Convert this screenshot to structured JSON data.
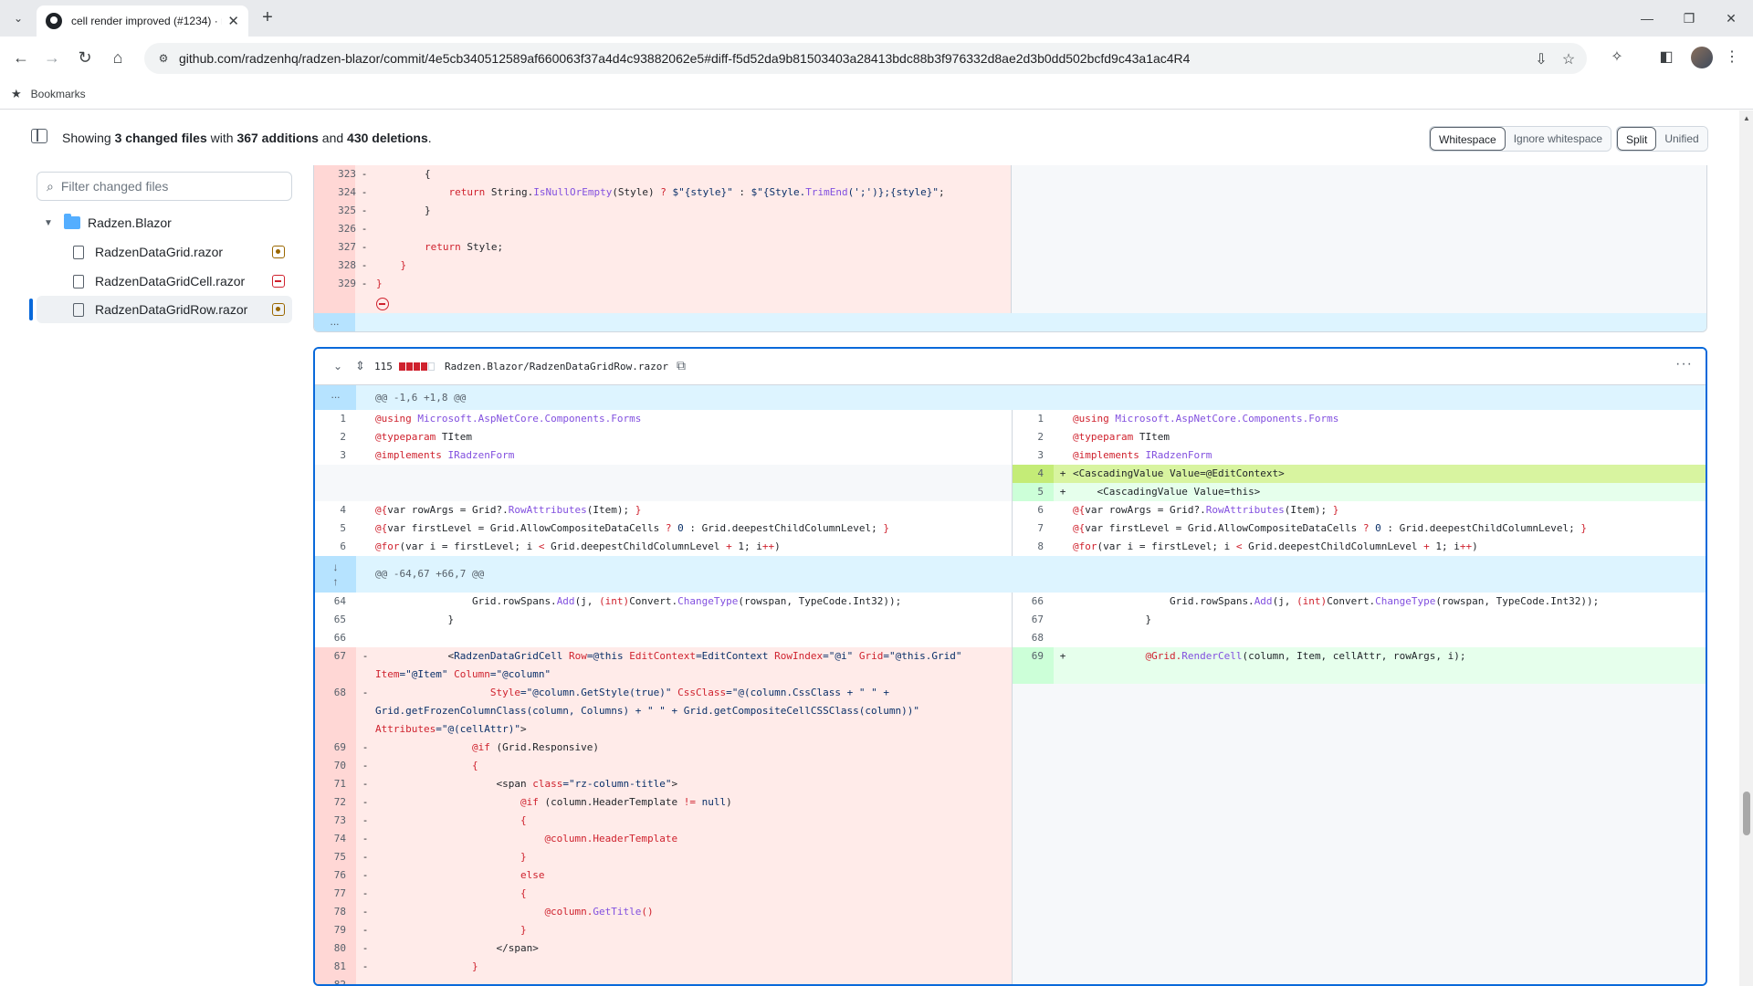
{
  "browser": {
    "tab_title": "cell render improved (#1234) · r",
    "url": "github.com/radzenhq/radzen-blazor/commit/4e5cb340512589af660063f37a4d4c93882062e5#diff-f5d52da9b81503403a28413bdc88b3f976332d8ae2d3b0dd502bcfd9c43a1ac4R4",
    "bookmarks_label": "Bookmarks"
  },
  "summary": {
    "prefix": "Showing ",
    "files": "3 changed files",
    "mid1": " with ",
    "additions": "367 additions",
    "mid2": " and ",
    "deletions": "430 deletions",
    "suffix": "."
  },
  "view_options": {
    "whitespace": "Whitespace",
    "ignore_whitespace": "Ignore whitespace",
    "split": "Split",
    "unified": "Unified"
  },
  "file_tree": {
    "filter_placeholder": "Filter changed files",
    "folder": "Radzen.Blazor",
    "files": [
      "RadzenDataGrid.razor",
      "RadzenDataGridCell.razor",
      "RadzenDataGridRow.razor"
    ]
  },
  "file_header": {
    "changes": "115",
    "path": "Radzen.Blazor/RadzenDataGridRow.razor"
  },
  "hunks": {
    "h1": "@@ -1,6 +1,8 @@",
    "h2": "@@ -64,67 +66,7 @@",
    "expand": "..."
  },
  "colors": {
    "deleted_bg": "#ffebe9",
    "added_bg": "#e6ffec",
    "hunk_bg": "#ddf4ff",
    "accent": "#0969da"
  }
}
